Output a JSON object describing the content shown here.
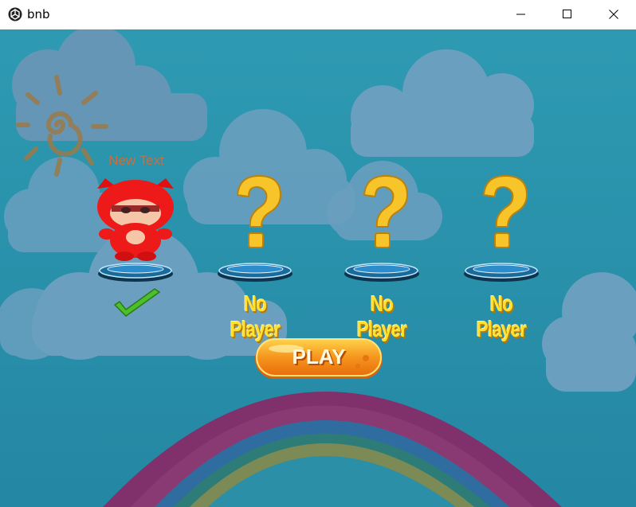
{
  "window": {
    "title": "bnb",
    "icon": "unity-icon",
    "controls": [
      "minimize-icon",
      "maximize-icon",
      "close-icon"
    ]
  },
  "game": {
    "player1": {
      "name_label": "New Text",
      "character": "red-character",
      "ready": true
    },
    "slots": [
      {
        "label": "No Player",
        "icon": "question-mark-icon"
      },
      {
        "label": "No Player",
        "icon": "question-mark-icon"
      },
      {
        "label": "No Player",
        "icon": "question-mark-icon"
      }
    ],
    "play_button": {
      "label": "PLAY"
    }
  },
  "colors": {
    "sky": "#2a8fa7",
    "cloud": "#5f9bb9",
    "accent_yellow": "#ffe030",
    "play_orange": "#f5951e",
    "label_orange": "#c96e3c"
  }
}
